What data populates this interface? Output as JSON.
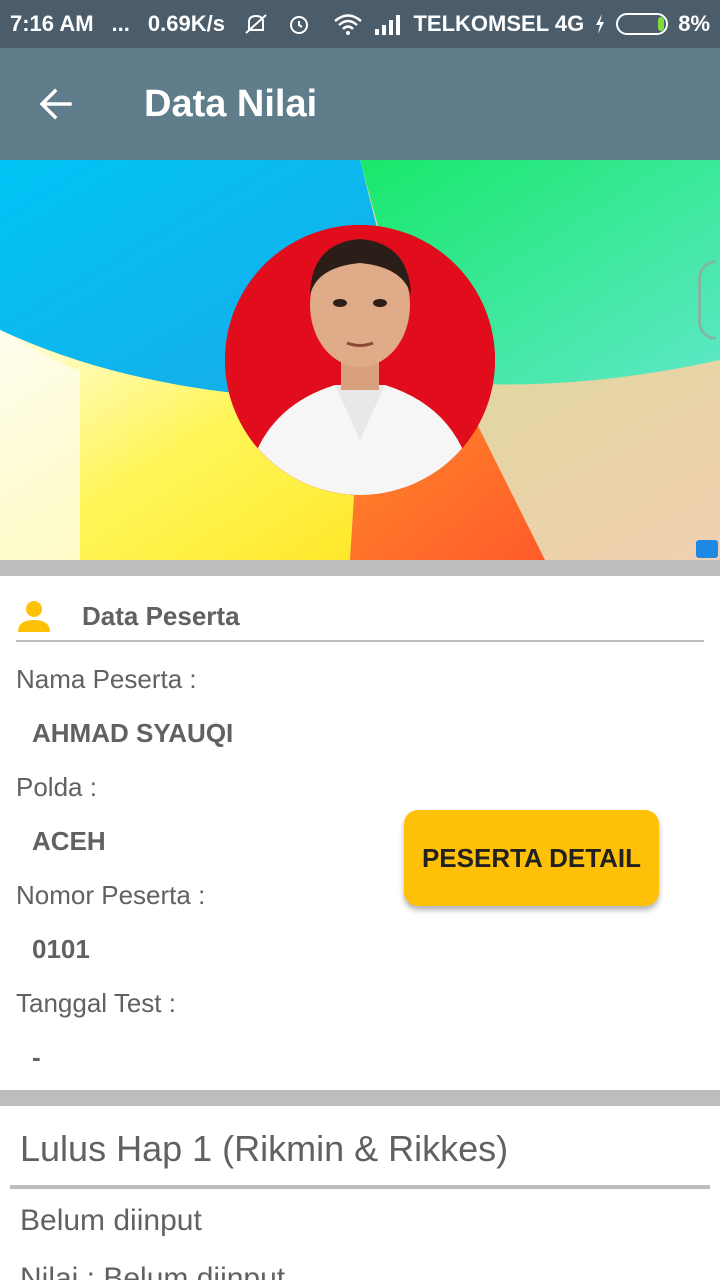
{
  "status_bar": {
    "time": "7:16 AM",
    "dots": "...",
    "speed": "0.69K/s",
    "carrier": "TELKOMSEL 4G",
    "battery": "8%"
  },
  "toolbar": {
    "title": "Data Nilai",
    "back_icon": "arrow-back-icon"
  },
  "section": {
    "title": "Data Peserta",
    "icon": "person-icon",
    "icon_color": "#ffc107"
  },
  "fields": {
    "nama_label": "Nama Peserta :",
    "nama_value": "AHMAD SYAUQI",
    "polda_label": "Polda :",
    "polda_value": "ACEH",
    "nomor_label": "Nomor Peserta :",
    "nomor_value": "0101",
    "tanggal_label": "Tanggal Test :",
    "tanggal_value": "-"
  },
  "detail_button": {
    "label": "PESERTA DETAIL",
    "color": "#ffc107"
  },
  "result": {
    "title": "Lulus Hap 1 (Rikmin & Rikkes)",
    "status": "Belum diinput",
    "nilai": "Nilai : Belum diinput"
  },
  "colors": {
    "toolbar": "#607d8b",
    "status_bar": "#4b5d6b"
  }
}
